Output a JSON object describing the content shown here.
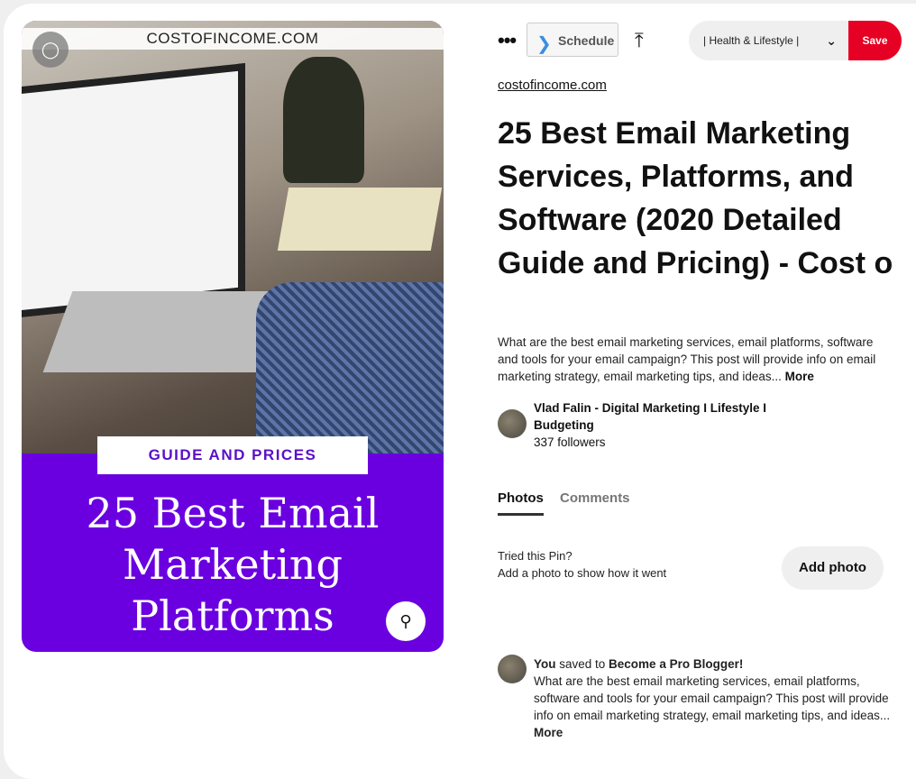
{
  "pin_image": {
    "site_text": "COSTOFINCOME.COM",
    "band_text": "GUIDE AND PRICES",
    "title_lines": [
      "25 Best Email",
      "Marketing",
      "Platforms"
    ],
    "tag_icon": "tag-icon",
    "lens_icon": "visual-search-icon",
    "brand_purple": "#6a00e0"
  },
  "toolbar": {
    "more_label": "•••",
    "schedule_label": "Schedule",
    "share_icon": "upload-icon",
    "board_label": "| Health & Lifestyle |",
    "save_label": "Save",
    "save_color": "#e60023"
  },
  "pin": {
    "source_link": "costofincome.com",
    "title": "25 Best Email Marketing Services, Platforms, and Software (2020 Detailed Guide and Pricing) - Cost o",
    "description": "What are the best email marketing services, email platforms, software and tools for your email campaign? This post will provide info on email marketing strategy, email marketing tips, and ideas...",
    "more_label": "More"
  },
  "author": {
    "name": "Vlad Falin - Digital Marketing I Lifestyle I Budgeting",
    "followers": "337 followers"
  },
  "tabs": [
    {
      "label": "Photos",
      "active": true
    },
    {
      "label": "Comments",
      "active": false
    }
  ],
  "tried": {
    "line1": "Tried this Pin?",
    "line2": "Add a photo to show how it went",
    "button": "Add photo"
  },
  "activity": {
    "actor": "You",
    "verb": " saved to ",
    "board": "Become a Pro Blogger!",
    "description": "What are the best email marketing services, email platforms, software and tools for your email campaign? This post will provide info on email marketing strategy, email marketing tips, and ideas...",
    "more_label": "More"
  }
}
